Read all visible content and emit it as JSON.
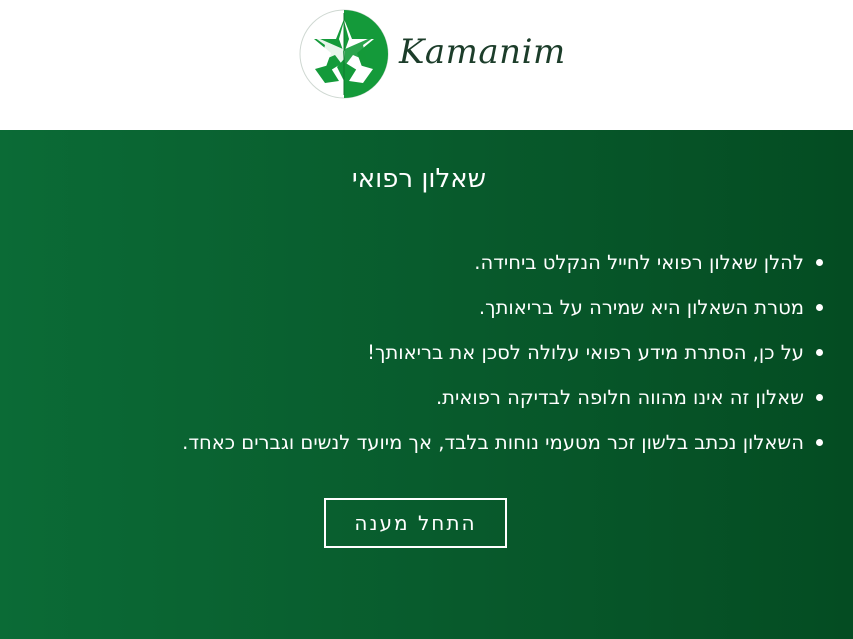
{
  "header": {
    "logo_text": "Kamanim",
    "logo_icon": "star-emblem-icon"
  },
  "main": {
    "title": "שאלון רפואי",
    "bullets": [
      "להלן שאלון רפואי לחייל הנקלט ביחידה.",
      "מטרת השאלון היא שמירה על בריאותך.",
      "על כן, הסתרת מידע רפואי עלולה לסכן את בריאותך!",
      "שאלון זה אינו מהווה חלופה לבדיקה רפואית.",
      "השאלון נכתב בלשון זכר מטעמי נוחות בלבד, אך מיועד לנשים וגברים כאחד."
    ],
    "start_button_label": "התחל מענה"
  },
  "colors": {
    "brand_green": "#0b6b36",
    "brand_green_dark": "#044c22",
    "logo_text": "#1c3d2a",
    "text_on_green": "#ffffff"
  }
}
